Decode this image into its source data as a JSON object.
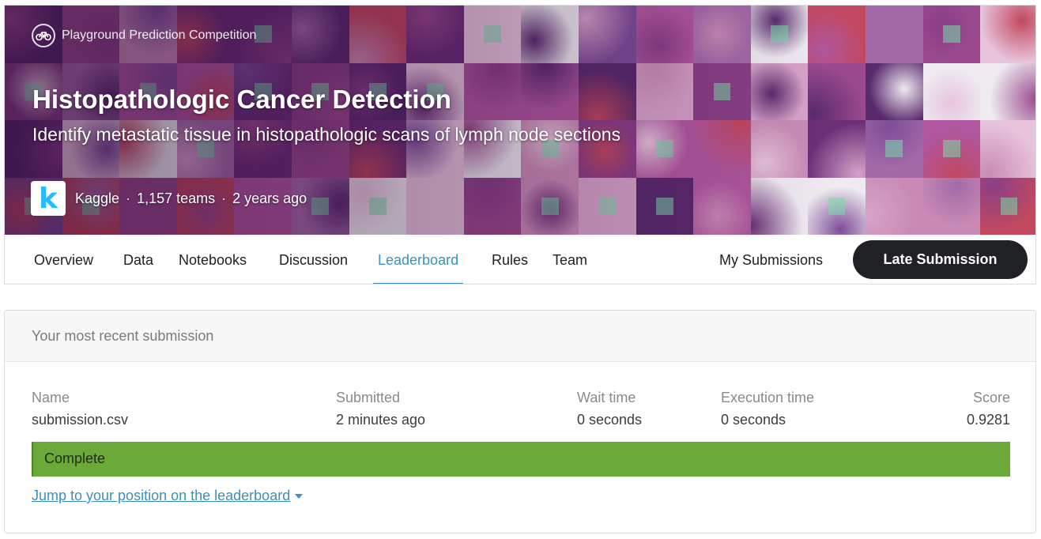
{
  "colors": {
    "accent": "#3a8fc3",
    "status_complete": "#6ca93b",
    "button_dark": "#202124",
    "kaggle_blue": "#20beff"
  },
  "banner": {
    "competition_type": "Playground Prediction Competition",
    "competition_type_icon": "bicycle-icon",
    "title": "Histopathologic Cancer Detection",
    "subtitle": "Identify metastatic tissue in histopathologic scans of lymph node sections",
    "host_logo_letter": "k",
    "host": "Kaggle",
    "teams": "1,157 teams",
    "age": "2 years ago"
  },
  "nav": {
    "tabs": [
      {
        "label": "Overview",
        "active": false
      },
      {
        "label": "Data",
        "active": false
      },
      {
        "label": "Notebooks",
        "active": false
      },
      {
        "label": "Discussion",
        "active": false
      },
      {
        "label": "Leaderboard",
        "active": true
      },
      {
        "label": "Rules",
        "active": false
      },
      {
        "label": "Team",
        "active": false
      }
    ],
    "my_submissions": "My Submissions",
    "late_submission": "Late Submission"
  },
  "submission": {
    "header": "Your most recent submission",
    "columns": {
      "name": {
        "label": "Name",
        "value": "submission.csv"
      },
      "submitted": {
        "label": "Submitted",
        "value": "2 minutes ago"
      },
      "wait_time": {
        "label": "Wait time",
        "value": "0 seconds"
      },
      "execution_time": {
        "label": "Execution time",
        "value": "0 seconds"
      },
      "score": {
        "label": "Score",
        "value": "0.9281"
      }
    },
    "status": "Complete",
    "jump_link": "Jump to your position on the leaderboard"
  }
}
